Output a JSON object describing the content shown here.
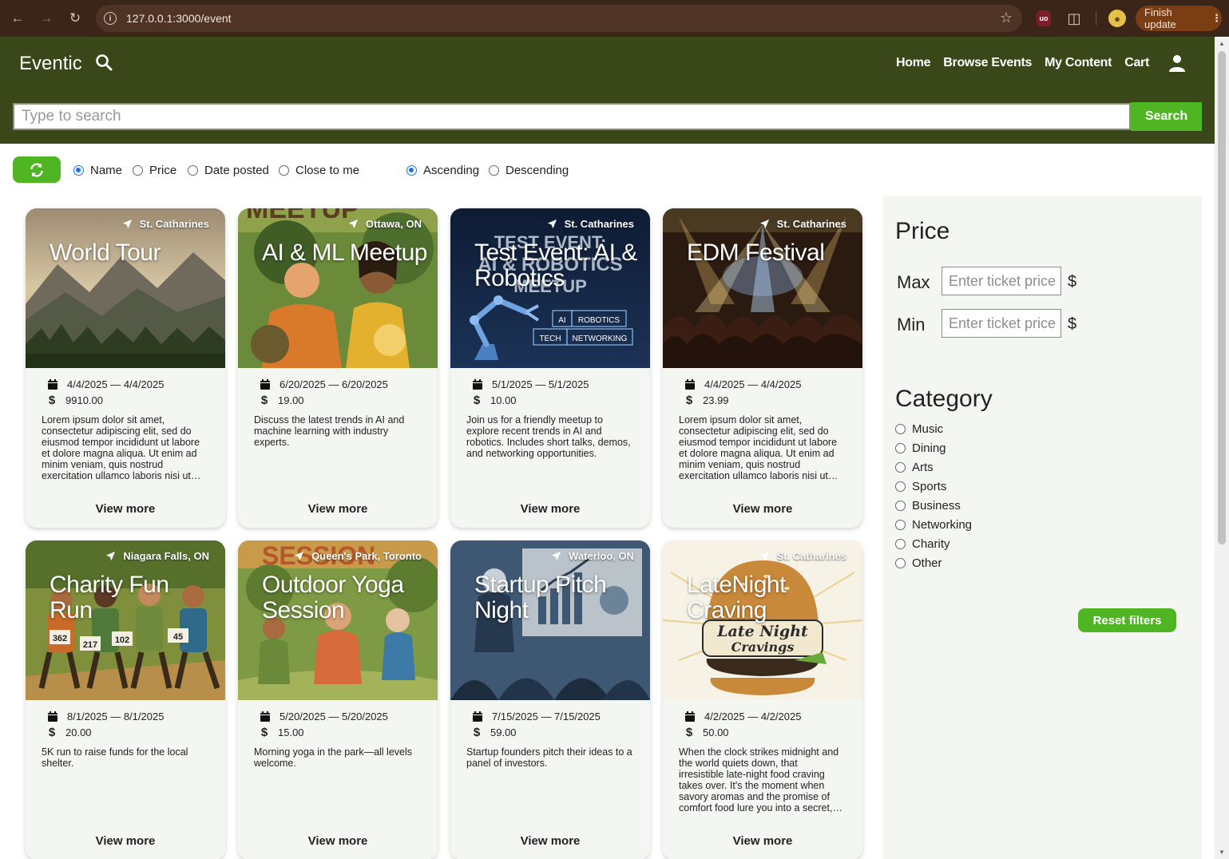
{
  "browser": {
    "url": "127.0.0.1:3000/event",
    "update_label": "Finish update"
  },
  "header": {
    "brand": "Eventic",
    "nav": [
      "Home",
      "Browse Events",
      "My Content",
      "Cart"
    ],
    "search_placeholder": "Type to search",
    "search_button": "Search"
  },
  "sort": {
    "fields": [
      "Name",
      "Price",
      "Date posted",
      "Close to me"
    ],
    "selected_field": "Name",
    "orders": [
      "Ascending",
      "Descending"
    ],
    "selected_order": "Ascending"
  },
  "events": [
    {
      "title": "World Tour",
      "location": "St. Catharines",
      "dates": "4/4/2025 — 4/4/2025",
      "price": "9910.00",
      "description": "Lorem ipsum dolor sit amet, consectetur adipiscing elit, sed do eiusmod tempor incididunt ut labore et dolore magna aliqua. Ut enim ad minim veniam, quis nostrud exercitation ullamco laboris nisi ut aliquip ex ea commodo consequat.",
      "view_more": "View more",
      "image": "mountain-forest-landscape"
    },
    {
      "title": "AI & ML Meetup",
      "location": "Ottawa, ON",
      "dates": "6/20/2025 — 6/20/2025",
      "price": "19.00",
      "description": "Discuss the latest trends in AI and machine learning with industry experts.",
      "view_more": "View more",
      "image": "illustrated-people-talking"
    },
    {
      "title": "Test Event: AI & Robotics",
      "location": "St. Catharines",
      "dates": "5/1/2025 — 5/1/2025",
      "price": "10.00",
      "description": "Join us for a friendly meetup to explore recent trends in AI and robotics. Includes short talks, demos, and networking opportunities.",
      "view_more": "View more",
      "image": "robot-arm-tech-poster"
    },
    {
      "title": "EDM Festival",
      "location": "St. Catharines",
      "dates": "4/4/2025 — 4/4/2025",
      "price": "23.99",
      "description": "Lorem ipsum dolor sit amet, consectetur adipiscing elit, sed do eiusmod tempor incididunt ut labore et dolore magna aliqua. Ut enim ad minim veniam, quis nostrud exercitation ullamco laboris nisi ut aliquip ex ea commodo consequat.",
      "view_more": "View more",
      "image": "concert-crowd-lights"
    },
    {
      "title": "Charity Fun Run",
      "location": "Niagara Falls, ON",
      "dates": "8/1/2025 — 8/1/2025",
      "price": "20.00",
      "description": "5K run to raise funds for the local shelter.",
      "view_more": "View more",
      "image": "illustrated-runners"
    },
    {
      "title": "Outdoor Yoga Session",
      "location": "Queen's Park, Toronto",
      "dates": "5/20/2025 — 5/20/2025",
      "price": "15.00",
      "description": "Morning yoga in the park—all levels welcome.",
      "view_more": "View more",
      "image": "illustrated-yoga-group"
    },
    {
      "title": "Startup Pitch Night",
      "location": "Waterloo, ON",
      "dates": "7/15/2025 — 7/15/2025",
      "price": "59.00",
      "description": "Startup founders pitch their ideas to a panel of investors.",
      "view_more": "View more",
      "image": "illustrated-pitch-presentation"
    },
    {
      "title": "LateNight Craving",
      "location": "St. Catharines",
      "dates": "4/2/2025 — 4/2/2025",
      "price": "50.00",
      "description": "When the clock strikes midnight and the world quiets down, that irresistible late-night food craving takes over. It's the moment when savory aromas and the promise of comfort food lure you into a secret, delicious world.",
      "view_more": "View more",
      "image": "burger-logo"
    }
  ],
  "filters": {
    "price_heading": "Price",
    "max_label": "Max",
    "min_label": "Min",
    "price_placeholder": "Enter ticket price",
    "currency": "$",
    "category_heading": "Category",
    "categories": [
      "Music",
      "Dining",
      "Arts",
      "Sports",
      "Business",
      "Networking",
      "Charity",
      "Other"
    ],
    "reset_label": "Reset filters"
  },
  "image_text": {
    "ai_poster_heading": "TEST EVENT:\nAI & ROBOTICS\nMEETUP",
    "ai_poster_tags": [
      "AI",
      "ROBOTICS",
      "TECH",
      "NETWORKING"
    ],
    "meetup_banner": "MEETUP",
    "session_banner": "SESSION",
    "run_bibs": [
      "362",
      "217",
      "102",
      "45"
    ],
    "latenight_logo": [
      "Late Night",
      "Cravings"
    ]
  },
  "colors": {
    "header_bg": "#3a4718",
    "accent_green": "#4fb523",
    "card_bg": "#f4f6f1"
  }
}
